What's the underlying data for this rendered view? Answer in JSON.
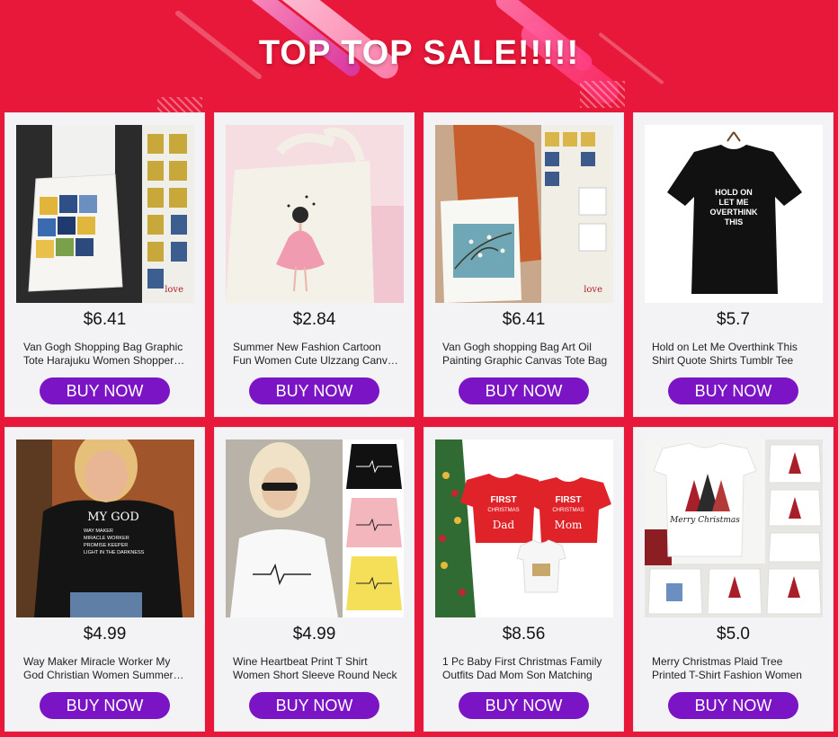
{
  "banner": {
    "title": "TOP TOP SALE!!!!!"
  },
  "products": [
    {
      "price": "$6.41",
      "title": "Van Gogh Shopping Bag Graphic Tote Harajuku Women Shopper Bag",
      "button": "BUY NOW",
      "image": "tote-bag-van-gogh"
    },
    {
      "price": "$2.84",
      "title": "Summer New Fashion Cartoon Fun Women Cute Ulzzang Canvas Bag",
      "button": "BUY NOW",
      "image": "tote-bag-ballerina"
    },
    {
      "price": "$6.41",
      "title": "Van Gogh shopping Bag Art Oil Painting Graphic Canvas Tote Bag",
      "button": "BUY NOW",
      "image": "tote-bag-almond-blossom"
    },
    {
      "price": "$5.7",
      "title": "Hold on Let Me Overthink This Shirt Quote Shirts Tumblr Tee",
      "button": "BUY NOW",
      "image": "tshirt-hold-on"
    },
    {
      "price": "$4.99",
      "title": "Way Maker Miracle Worker My God Christian Women Summer Tee",
      "button": "BUY NOW",
      "image": "tshirt-my-god"
    },
    {
      "price": "$4.99",
      "title": "Wine Heartbeat Print T Shirt Women Short Sleeve Round Neck",
      "button": "BUY NOW",
      "image": "tshirt-wine-heartbeat"
    },
    {
      "price": "$8.56",
      "title": "1 Pc Baby First Christmas Family Outfits Dad Mom Son Matching",
      "button": "BUY NOW",
      "image": "tshirt-first-christmas"
    },
    {
      "price": "$5.0",
      "title": "Merry Christmas Plaid Tree Printed T-Shirt Fashion Women",
      "button": "BUY NOW",
      "image": "tshirt-merry-christmas"
    }
  ],
  "image_text": {
    "hold_on": [
      "HOLD ON",
      "LET ME",
      "OVERTHINK",
      "THIS"
    ],
    "my_god": [
      "MY GOD",
      "WAY MAKER",
      "MIRACLE WORKER",
      "PROMISE KEEPER",
      "LIGHT IN THE DARKNESS"
    ],
    "first_christmas": [
      "FIRST",
      "CHRISTMAS",
      "AS",
      "Dad",
      "Mom"
    ],
    "merry_christmas": "Merry Christmas",
    "love_your_self": "love your self"
  },
  "colors": {
    "background": "#e8183a",
    "button": "#7a14c4",
    "card": "#f3f3f5"
  }
}
